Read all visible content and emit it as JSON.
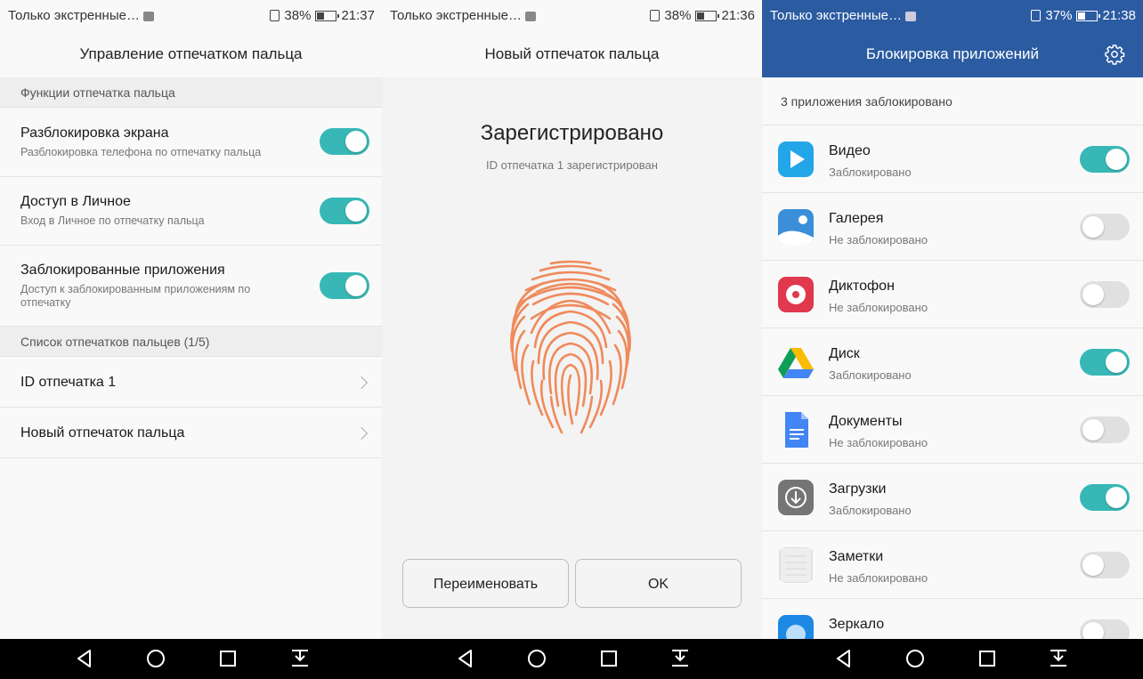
{
  "screen1": {
    "status": {
      "notification": "Только экстренные…",
      "battery": "38%",
      "time": "21:37"
    },
    "title": "Управление отпечатком пальца",
    "section1": "Функции отпечатка пальца",
    "items": [
      {
        "title": "Разблокировка экрана",
        "subtitle": "Разблокировка телефона по отпечатку пальца",
        "enabled": true
      },
      {
        "title": "Доступ в Личное",
        "subtitle": "Вход в Личное по отпечатку пальца",
        "enabled": true
      },
      {
        "title": "Заблокированные приложения",
        "subtitle": "Доступ к заблокированным приложениям по отпечатку",
        "enabled": true
      }
    ],
    "section2": "Список отпечатков пальцев (1/5)",
    "fingerprints": [
      {
        "label": "ID отпечатка 1"
      },
      {
        "label": "Новый отпечаток пальца"
      }
    ]
  },
  "screen2": {
    "status": {
      "notification": "Только экстренные…",
      "battery": "38%",
      "time": "21:36"
    },
    "title": "Новый отпечаток пальца",
    "heading": "Зарегистрировано",
    "subheading": "ID отпечатка 1 зарегистрирован",
    "rename_label": "Переименовать",
    "ok_label": "OK",
    "fingerprint_color": "#ef8a5b"
  },
  "screen3": {
    "status": {
      "notification": "Только экстренные…",
      "battery": "37%",
      "time": "21:38"
    },
    "title": "Блокировка приложений",
    "summary": "3 приложения заблокировано",
    "header_color": "#2b5ba1",
    "apps": [
      {
        "name": "Видео",
        "status": "Заблокировано",
        "locked": true,
        "icon": "video-icon"
      },
      {
        "name": "Галерея",
        "status": "Не заблокировано",
        "locked": false,
        "icon": "gallery-icon"
      },
      {
        "name": "Диктофон",
        "status": "Не заблокировано",
        "locked": false,
        "icon": "recorder-icon"
      },
      {
        "name": "Диск",
        "status": "Заблокировано",
        "locked": true,
        "icon": "drive-icon"
      },
      {
        "name": "Документы",
        "status": "Не заблокировано",
        "locked": false,
        "icon": "docs-icon"
      },
      {
        "name": "Загрузки",
        "status": "Заблокировано",
        "locked": true,
        "icon": "downloads-icon"
      },
      {
        "name": "Заметки",
        "status": "Не заблокировано",
        "locked": false,
        "icon": "notes-icon"
      },
      {
        "name": "Зеркало",
        "status": "",
        "locked": false,
        "icon": "mirror-icon"
      }
    ]
  },
  "colors": {
    "toggle_on": "#37b8b6",
    "toggle_off": "#e0e0e0"
  }
}
